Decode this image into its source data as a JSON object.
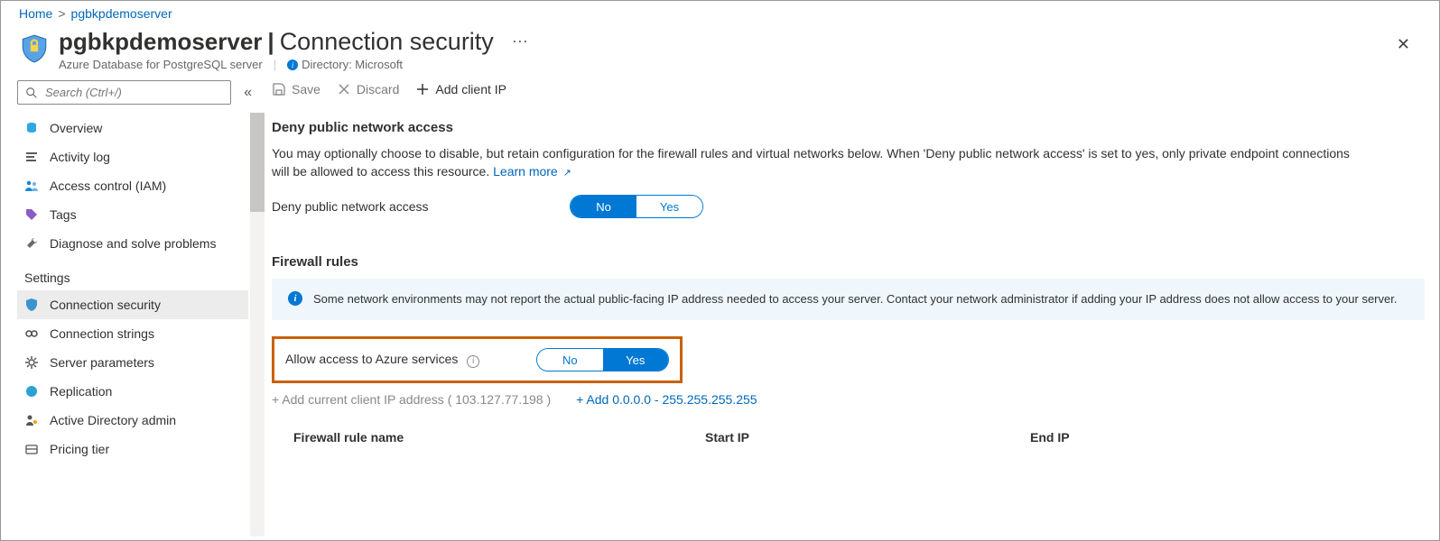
{
  "breadcrumb": {
    "home": "Home",
    "server": "pgbkpdemoserver"
  },
  "header": {
    "name": "pgbkpdemoserver",
    "page": "Connection security",
    "type": "Azure Database for PostgreSQL server",
    "directory_label": "Directory: Microsoft"
  },
  "search": {
    "placeholder": "Search (Ctrl+/)"
  },
  "nav": {
    "overview": "Overview",
    "activity_log": "Activity log",
    "iam": "Access control (IAM)",
    "tags": "Tags",
    "diagnose": "Diagnose and solve problems",
    "section_settings": "Settings",
    "conn_sec": "Connection security",
    "conn_str": "Connection strings",
    "server_params": "Server parameters",
    "replication": "Replication",
    "ad_admin": "Active Directory admin",
    "pricing": "Pricing tier"
  },
  "toolbar": {
    "save": "Save",
    "discard": "Discard",
    "add_ip": "Add client IP"
  },
  "deny_section": {
    "title": "Deny public network access",
    "desc": "You may optionally choose to disable, but retain configuration for the firewall rules and virtual networks below. When 'Deny public network access' is set to yes, only private endpoint connections will be allowed to access this resource.",
    "learn": "Learn more",
    "label": "Deny public network access",
    "no": "No",
    "yes": "Yes"
  },
  "firewall": {
    "title": "Firewall rules",
    "info": "Some network environments may not report the actual public-facing IP address needed to access your server.  Contact your network administrator if adding your IP address does not allow access to your server.",
    "allow_label": "Allow access to Azure services",
    "no": "No",
    "yes": "Yes",
    "add_current": "+ Add current client IP address ( 103.127.77.198 )",
    "add_range": "+ Add 0.0.0.0 - 255.255.255.255",
    "col_name": "Firewall rule name",
    "col_start": "Start IP",
    "col_end": "End IP"
  }
}
